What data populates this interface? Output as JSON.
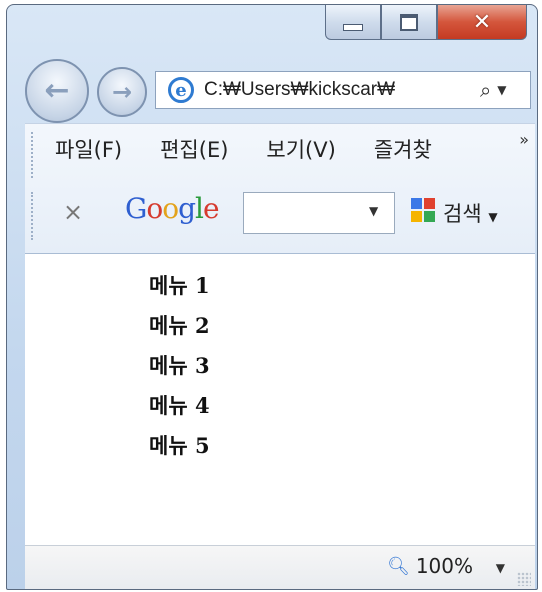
{
  "window": {
    "caption_buttons": {
      "minimize": "minimize-icon",
      "maximize": "maximize-icon",
      "close": "✕"
    }
  },
  "navigation": {
    "back_icon": "back-arrow-icon",
    "forward_icon": "forward-arrow-icon",
    "address": "C:₩Users₩kickscar₩",
    "search_icon": "search-icon",
    "dropdown_icon": "chevron-down-icon"
  },
  "menubar": {
    "items": [
      "파일(F)",
      "편집(E)",
      "보기(V)",
      "즐겨찾"
    ],
    "overflow": "»"
  },
  "google_toolbar": {
    "close": "×",
    "logo": [
      "G",
      "o",
      "o",
      "g",
      "l",
      "e"
    ],
    "logo_colors": [
      "#2f5fd0",
      "#d63b2f",
      "#e3a31c",
      "#2f5fd0",
      "#2a9b3b",
      "#d63b2f"
    ],
    "search_value": "",
    "search_button": "검색"
  },
  "content": {
    "menu_items": [
      "메뉴 1",
      "메뉴 2",
      "메뉴 3",
      "메뉴 4",
      "메뉴 5"
    ]
  },
  "statusbar": {
    "zoom": "100%"
  }
}
